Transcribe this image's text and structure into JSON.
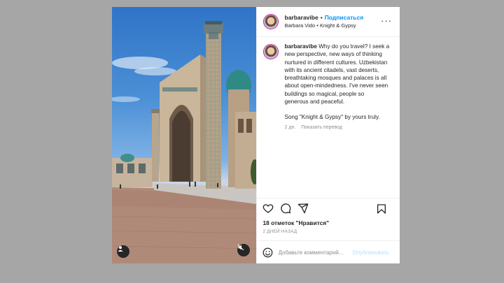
{
  "post": {
    "author": {
      "username": "barbaravibe",
      "follow_label": "Подписаться",
      "subtitle_left": "Barbara Vido",
      "subtitle_right": "Knight & Gypsy"
    },
    "more_icon": "more-horizontal-icon",
    "caption": {
      "username": "barbaravibe",
      "text": "Why do you travel? I seek a new perspective, new ways of thinking nurtured in different cultures. Uzbekistan with its ancient citadels, vast deserts, breathtaking mosques and palaces is all about open-mindedness. I've never seen buildings so magical, people so generous and peaceful.",
      "song_line": "Song \"Knight & Gypsy\" by yours truly.",
      "time_ago": "2 дн.",
      "translate_label": "Показать перевод"
    },
    "actions": {
      "icons": [
        "heart-icon",
        "comment-icon",
        "share-icon",
        "bookmark-icon"
      ]
    },
    "likes_text": "18 отметок \"Нравится\"",
    "date_text": "2 ДНЕЙ НАЗАД",
    "comment": {
      "placeholder": "Добавьте комментарий...",
      "publish_label": "Опубликовать"
    },
    "media": {
      "icons": [
        "user-tag-icon",
        "muted-speaker-icon"
      ]
    }
  },
  "colors": {
    "backdrop": "#a6a6a6",
    "link_blue": "#0095f6",
    "publish_disabled": "#b2dffc",
    "muted_text": "#8e8e8e",
    "story_ring": "#d6249f"
  }
}
